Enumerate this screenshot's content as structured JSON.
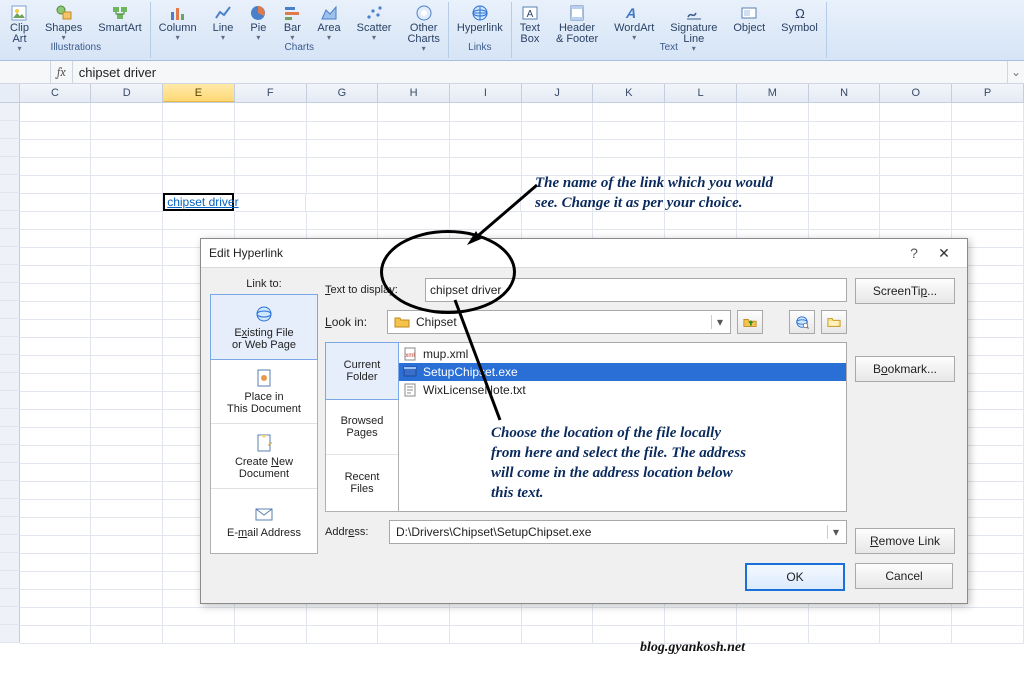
{
  "ribbon": {
    "groups": [
      {
        "label": "Illustrations",
        "items": [
          {
            "n": "Clip Art",
            "dd": "▾"
          },
          {
            "n": "Shapes",
            "dd": "▾"
          },
          {
            "n": "SmartArt"
          }
        ]
      },
      {
        "label": "Charts",
        "items": [
          {
            "n": "Column",
            "dd": "▾"
          },
          {
            "n": "Line",
            "dd": "▾"
          },
          {
            "n": "Pie",
            "dd": "▾"
          },
          {
            "n": "Bar",
            "dd": "▾"
          },
          {
            "n": "Area",
            "dd": "▾"
          },
          {
            "n": "Scatter",
            "dd": "▾"
          },
          {
            "n": "Other Charts",
            "dd": "▾"
          }
        ]
      },
      {
        "label": "Links",
        "items": [
          {
            "n": "Hyperlink"
          }
        ]
      },
      {
        "label": "Text",
        "items": [
          {
            "n": "Text Box"
          },
          {
            "n": "Header & Footer"
          },
          {
            "n": "WordArt",
            "dd": "▾"
          },
          {
            "n": "Signature Line",
            "dd": "▾"
          },
          {
            "n": "Object"
          },
          {
            "n": "Symbol"
          }
        ]
      }
    ]
  },
  "formula": {
    "fx": "fx",
    "value": "chipset driver"
  },
  "columns": [
    "C",
    "D",
    "E",
    "F",
    "G",
    "H",
    "I",
    "J",
    "K",
    "L",
    "M",
    "N",
    "O",
    "P"
  ],
  "selected_col": "E",
  "cell_link": "chipset driver",
  "annotations": {
    "top": "The name of the link which you would see. Change it as per your choice.",
    "mid": "Choose the location of the file locally from here and select the file. The address will come in the address location below this text.",
    "water": "blog.gyankosh.net"
  },
  "dialog": {
    "title": "Edit Hyperlink",
    "link_to": "Link to:",
    "options": [
      {
        "label": "Existing File or Web Page",
        "ak": "x",
        "sel": true
      },
      {
        "label": "Place in This Document",
        "ak": "A"
      },
      {
        "label": "Create New Document",
        "ak": "N"
      },
      {
        "label": "E-mail Address",
        "ak": "m"
      }
    ],
    "text_to_display_label": "Text to display:",
    "text_to_display": "chipset driver",
    "screentip": "ScreenTip...",
    "lookin_label": "Look in:",
    "lookin_value": "Chipset",
    "navtabs": [
      {
        "label": "Current Folder",
        "ak": "U",
        "sel": true
      },
      {
        "label": "Browsed Pages",
        "ak": "B"
      },
      {
        "label": "Recent Files",
        "ak": "C"
      }
    ],
    "files": [
      {
        "name": "mup.xml",
        "type": "xml"
      },
      {
        "name": "SetupChipset.exe",
        "type": "exe",
        "sel": true
      },
      {
        "name": "WixLicenseNote.txt",
        "type": "txt"
      }
    ],
    "bookmark": "Bookmark...",
    "remove": "Remove Link",
    "address_label": "Address:",
    "address": "D:\\Drivers\\Chipset\\SetupChipset.exe",
    "ok": "OK",
    "cancel": "Cancel"
  }
}
